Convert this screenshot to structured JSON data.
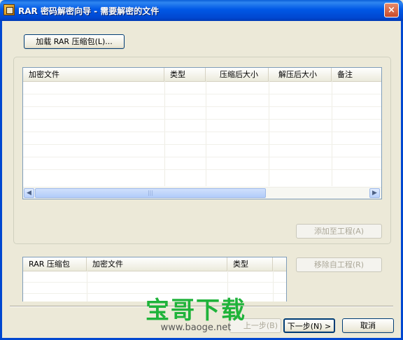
{
  "window": {
    "title": "RAR 密码解密向导 - 需要解密的文件",
    "close_icon": "×"
  },
  "buttons": {
    "load_rar": "加载 RAR 压缩包(L)...",
    "add_to_project": "添加至工程(A)",
    "remove_from_project": "移除自工程(R)",
    "prev": "上一步(B)",
    "next": "下一步(N) >",
    "cancel": "取消"
  },
  "file_list": {
    "columns": [
      "加密文件",
      "类型",
      "压缩后大小",
      "解压后大小",
      "备注"
    ],
    "rows": []
  },
  "project_list": {
    "columns": [
      "RAR 压缩包",
      "加密文件",
      "类型"
    ],
    "rows": []
  },
  "watermark": {
    "text": "宝哥下载",
    "url": "www.baoge.net"
  },
  "colors": {
    "titlebar": "#0058e6",
    "dialog_bg": "#ece9d8",
    "watermark": "#1fb33a"
  }
}
